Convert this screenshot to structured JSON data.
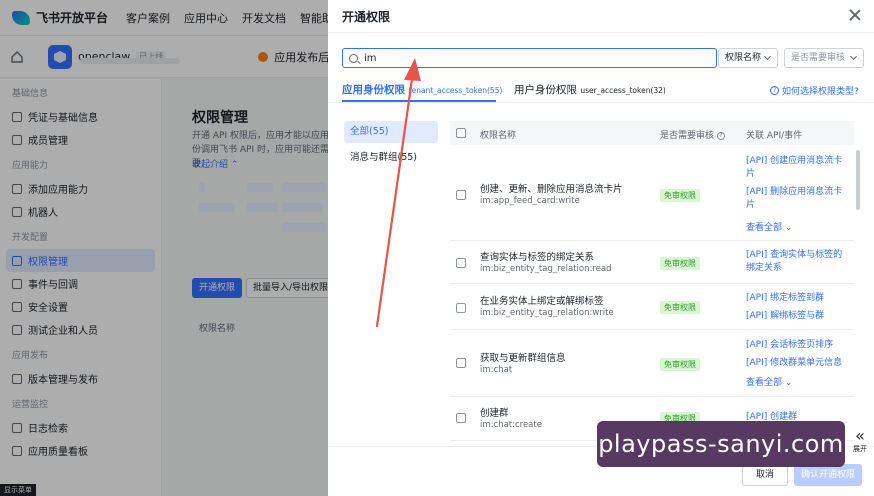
{
  "topnav": {
    "logo_text": "飞书开放平台",
    "items": [
      "客户案例",
      "应用中心",
      "开发文档",
      "智能助"
    ]
  },
  "appbar": {
    "app_name": "openclaw",
    "app_badge": "已上线",
    "publish_tip": "应用发布后，当前配置"
  },
  "sidebar": {
    "groups": [
      {
        "title": "基础信息",
        "items": [
          "凭证与基础信息",
          "成员管理"
        ]
      },
      {
        "title": "应用能力",
        "items": [
          "添加应用能力",
          "机器人"
        ]
      },
      {
        "title": "开发配置",
        "items": [
          "权限管理",
          "事件与回调",
          "安全设置",
          "测试企业和人员"
        ]
      },
      {
        "title": "应用发布",
        "items": [
          "版本管理与发布"
        ]
      },
      {
        "title": "运营监控",
        "items": [
          "日志检索",
          "应用质量看板"
        ]
      }
    ],
    "active_item": "权限管理",
    "show_menu": "显示菜单"
  },
  "main": {
    "title": "权限管理",
    "desc_line1": "开通 API 权限后，应用才能以应用",
    "desc_line2": "份调用飞书 API 时，应用可能还需要",
    "collapse": "收起介绍",
    "open_btn": "开通权限",
    "bulk_btn": "批量导入/导出权限",
    "column": "权限名称"
  },
  "drawer": {
    "title": "开通权限",
    "search": {
      "value": "im"
    },
    "select_perm": "权限名称",
    "select_review": "是否需要审核",
    "tab_app": "应用身份权限",
    "tab_app_sub": "tenant_access_token(55)",
    "tab_user": "用户身份权限",
    "tab_user_sub": "user_access_token(32)",
    "how_link": "如何选择权限类型?",
    "categories": [
      "全部(55)",
      "消息与群组(55)"
    ],
    "columns": [
      "权限名称",
      "是否需要审核",
      "关联 API/事件"
    ],
    "rows": [
      {
        "name": "创建、更新、删除应用消息流卡片",
        "key": "im:app_feed_card:write",
        "tag": "免审权限",
        "apis": [
          "[API] 创建应用消息流卡",
          "片",
          "[API] 删除应用消息流卡",
          "片"
        ],
        "more": "查看全部"
      },
      {
        "name": "查询实体与标签的绑定关系",
        "key": "im:biz_entity_tag_relation:read",
        "tag": "免审权限",
        "apis": [
          "[API] 查询实体与标签的",
          "绑定关系"
        ],
        "more": ""
      },
      {
        "name": "在业务实体上绑定或解绑标签",
        "key": "im:biz_entity_tag_relation:write",
        "tag": "免审权限",
        "apis": [
          "[API] 绑定标签到群",
          "[API] 解绑标签与群"
        ],
        "more": ""
      },
      {
        "name": "获取与更新群组信息",
        "key": "im:chat",
        "tag": "免审权限",
        "apis": [
          "[API] 会话标签页排序",
          "[API] 修改群菜单元信息"
        ],
        "more": "查看全部"
      },
      {
        "name": "创建群",
        "key": "im:chat:create",
        "tag": "免审权限",
        "apis": [
          "[API] 创建群"
        ],
        "more": ""
      }
    ],
    "cancel": "取消",
    "confirm": "确认开通权限"
  },
  "expand": {
    "label": "展开",
    "arrows": "«"
  },
  "watermark": "playpass-sanyi.com",
  "colors": {
    "accent": "#3370ff",
    "tag_bg": "#d9f5d6",
    "tag_text": "#2ea121",
    "arrow": "#e8534a"
  }
}
